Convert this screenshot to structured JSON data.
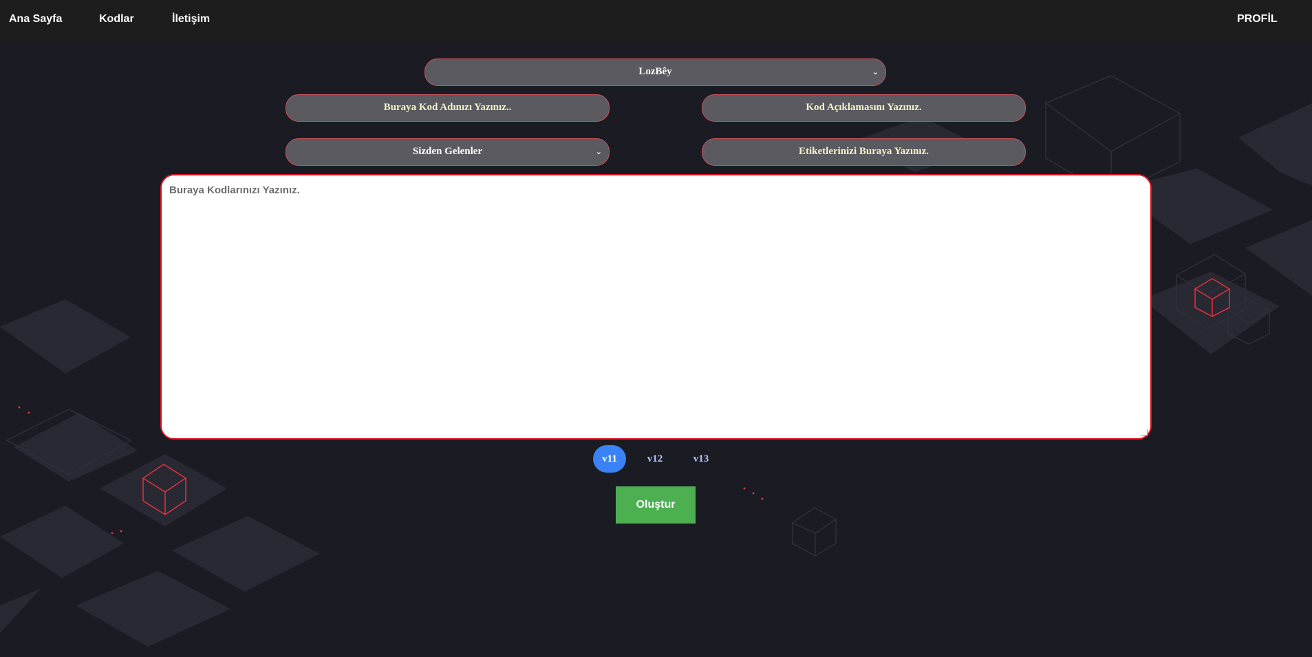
{
  "nav": {
    "home": "Ana Sayfa",
    "codes": "Kodlar",
    "contact": "İletişim",
    "profile": "PROFİL"
  },
  "form": {
    "user_select": "LozBêy",
    "code_name_placeholder": "Buraya Kod Adınızı Yazınız..",
    "code_desc_placeholder": "Kod Açıklamasını Yazınız.",
    "category_select": "Sizden Gelenler",
    "tags_placeholder": "Etiketlerinizi Buraya Yazınız.",
    "code_placeholder": "Buraya Kodlarınızı Yazınız."
  },
  "versions": [
    {
      "label": "v11",
      "active": true
    },
    {
      "label": "v12",
      "active": false
    },
    {
      "label": "v13",
      "active": false
    }
  ],
  "create_button": "Oluştur",
  "icons": {
    "chevron": "chevron-down-icon"
  },
  "colors": {
    "accent_red": "#e0111f",
    "active_version": "#3b82f6",
    "create_green": "#4caf50"
  }
}
